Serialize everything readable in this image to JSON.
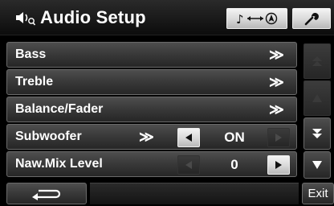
{
  "header": {
    "title": "Audio Setup",
    "title_icon": "speaker-settings-icon",
    "link_icon": "music-to-nav-icon",
    "tool_icon": "wrench-icon"
  },
  "menu": [
    {
      "label": "Bass",
      "chevron": "≫"
    },
    {
      "label": "Treble",
      "chevron": "≫"
    },
    {
      "label": "Balance/Fader",
      "chevron": "≫"
    }
  ],
  "subwoofer": {
    "label": "Subwoofer",
    "chevron": "≫",
    "value": "ON"
  },
  "mix_level": {
    "label": "Naw.Mix Level",
    "value": "0"
  },
  "footer": {
    "exit_label": "Exit",
    "back_icon": "back-arrow-icon"
  },
  "colors": {
    "accent_light": "#d8d8d8",
    "panel": "#3a3a3a"
  }
}
